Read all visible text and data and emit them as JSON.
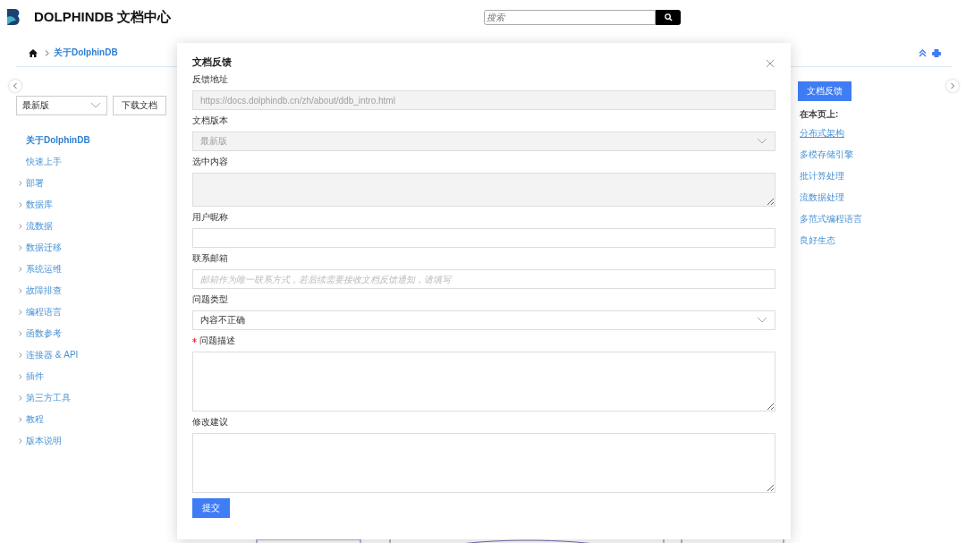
{
  "header": {
    "title": "DOLPHINDB 文档中心",
    "search_placeholder": "搜索"
  },
  "breadcrumb": [
    "关于DolphinDB"
  ],
  "sidebar": {
    "version": "最新版",
    "download_button": "下载文档",
    "items": [
      {
        "label": "关于DolphinDB",
        "kind": "leaf",
        "selected": true
      },
      {
        "label": "快速上手",
        "kind": "leaf",
        "selected": false
      },
      {
        "label": "部署",
        "kind": "group",
        "selected": false
      },
      {
        "label": "数据库",
        "kind": "group",
        "selected": false
      },
      {
        "label": "流数据",
        "kind": "group",
        "selected": false
      },
      {
        "label": "数据迁移",
        "kind": "group",
        "selected": false
      },
      {
        "label": "系统运维",
        "kind": "group",
        "selected": false
      },
      {
        "label": "故障排查",
        "kind": "group",
        "selected": false
      },
      {
        "label": "编程语言",
        "kind": "group",
        "selected": false
      },
      {
        "label": "函数参考",
        "kind": "group",
        "selected": false
      },
      {
        "label": "连接器 & API",
        "kind": "group",
        "selected": false
      },
      {
        "label": "插件",
        "kind": "group",
        "selected": false
      },
      {
        "label": "第三方工具",
        "kind": "group",
        "selected": false
      },
      {
        "label": "教程",
        "kind": "group",
        "selected": false
      },
      {
        "label": "版本说明",
        "kind": "group",
        "selected": false
      }
    ]
  },
  "toc": {
    "feedback_button": "文档反馈",
    "heading": "在本页上:",
    "links": [
      {
        "label": "分布式架构",
        "selected": true
      },
      {
        "label": "多模存储引擎",
        "selected": false
      },
      {
        "label": "批计算处理",
        "selected": false
      },
      {
        "label": "流数据处理",
        "selected": false
      },
      {
        "label": "多范式编程语言",
        "selected": false
      },
      {
        "label": "良好生态",
        "selected": false
      }
    ]
  },
  "dialog": {
    "title": "文档反馈",
    "fields": [
      {
        "label": "反馈地址",
        "kind": "input",
        "value": "https://docs.dolphindb.cn/zh/about/ddb_intro.html",
        "disabled": true,
        "required": false
      },
      {
        "label": "文档版本",
        "kind": "select",
        "value": "最新版",
        "disabled": true,
        "required": false
      },
      {
        "label": "选中内容",
        "kind": "textarea",
        "disabled": true,
        "required": false
      },
      {
        "label": "用户昵称",
        "kind": "input",
        "disabled": false,
        "required": false
      },
      {
        "label": "联系邮箱",
        "kind": "input",
        "placeholder": "邮箱作为唯一联系方式，若后续需要接收文档反馈通知，请填写",
        "disabled": false,
        "required": false
      },
      {
        "label": "问题类型",
        "kind": "select",
        "value": "内容不正确",
        "disabled": false,
        "required": false
      },
      {
        "label": "问题描述",
        "kind": "textarea",
        "disabled": false,
        "required": true
      },
      {
        "label": "修改建议",
        "kind": "textarea",
        "disabled": false,
        "required": false
      }
    ],
    "submit_button": "提交"
  }
}
